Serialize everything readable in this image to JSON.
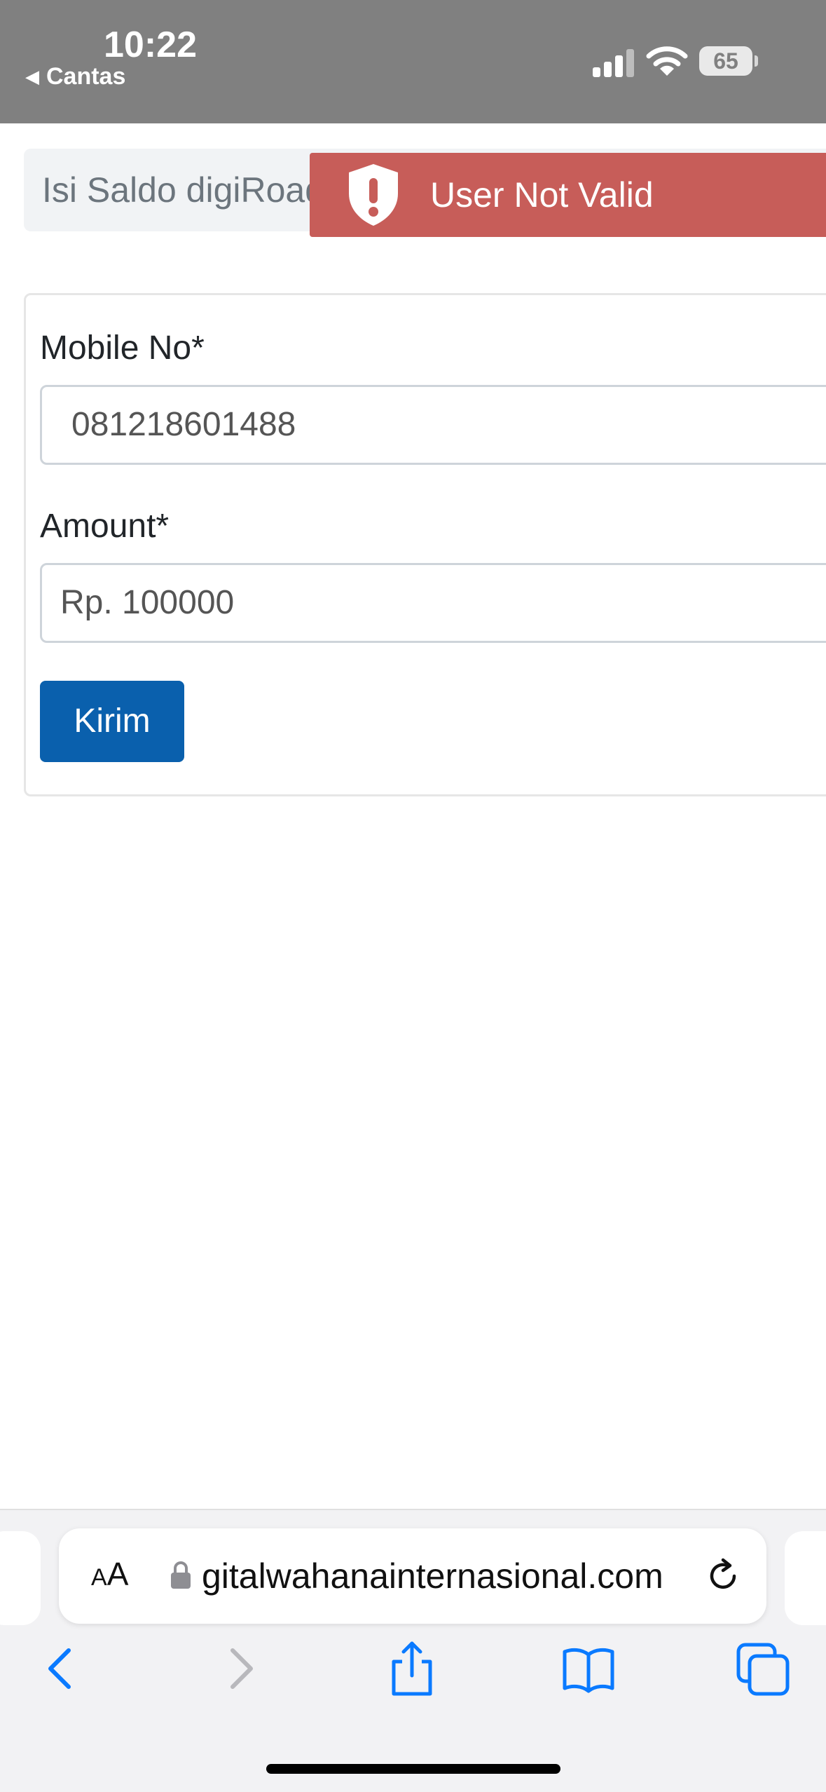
{
  "status_bar": {
    "time": "10:22",
    "back_app_label": "Cantas",
    "battery_level": "65"
  },
  "breadcrumb": {
    "text": "Isi Saldo digiRoad"
  },
  "toast": {
    "message": "User Not Valid",
    "color": "#c75d59",
    "icon": "shield-alert-icon"
  },
  "form": {
    "mobile_label": "Mobile No*",
    "mobile_value": "081218601488",
    "amount_label": "Amount*",
    "amount_value": "Rp. 100000",
    "submit_label": "Kirim",
    "submit_color": "#0a60ad"
  },
  "browser": {
    "aa_label_small": "A",
    "aa_label_large": "A",
    "url": "gitalwahanainternasional.com",
    "toolbar": [
      "back-icon",
      "forward-icon",
      "share-icon",
      "bookmarks-icon",
      "tabs-icon"
    ],
    "accent": "#0a7aff"
  }
}
